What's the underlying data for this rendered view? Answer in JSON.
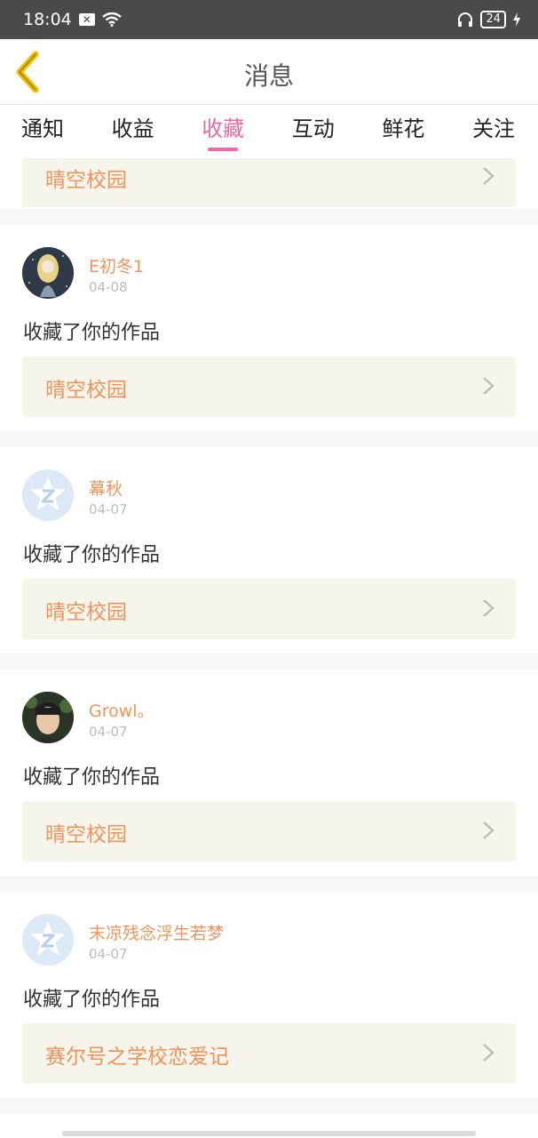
{
  "status_bar": {
    "time": "18:04",
    "battery": "24"
  },
  "header": {
    "title": "消息"
  },
  "tabs": [
    {
      "label": "通知"
    },
    {
      "label": "收益"
    },
    {
      "label": "收藏"
    },
    {
      "label": "互动"
    },
    {
      "label": "鲜花"
    },
    {
      "label": "关注"
    }
  ],
  "active_tab": "收藏",
  "partial_top": {
    "work_title": "晴空校园"
  },
  "messages": [
    {
      "username": "E初冬1",
      "date": "04-08",
      "action": "收藏了你的作品",
      "work_title": "晴空校园",
      "avatar": "illustrated-girl"
    },
    {
      "username": "幕秋",
      "date": "04-07",
      "action": "收藏了你的作品",
      "work_title": "晴空校园",
      "avatar": "default-star"
    },
    {
      "username": "Growl。",
      "date": "04-07",
      "action": "收藏了你的作品",
      "work_title": "晴空校园",
      "avatar": "photo-boy"
    },
    {
      "username": "末凉残念浮生若梦",
      "date": "04-07",
      "action": "收藏了你的作品",
      "work_title": "赛尔号之学校恋爱记",
      "avatar": "default-star"
    }
  ],
  "colors": {
    "accent_pink": "#e86aa6",
    "username_orange": "#f0935a",
    "back_arrow": "#f2c200"
  }
}
